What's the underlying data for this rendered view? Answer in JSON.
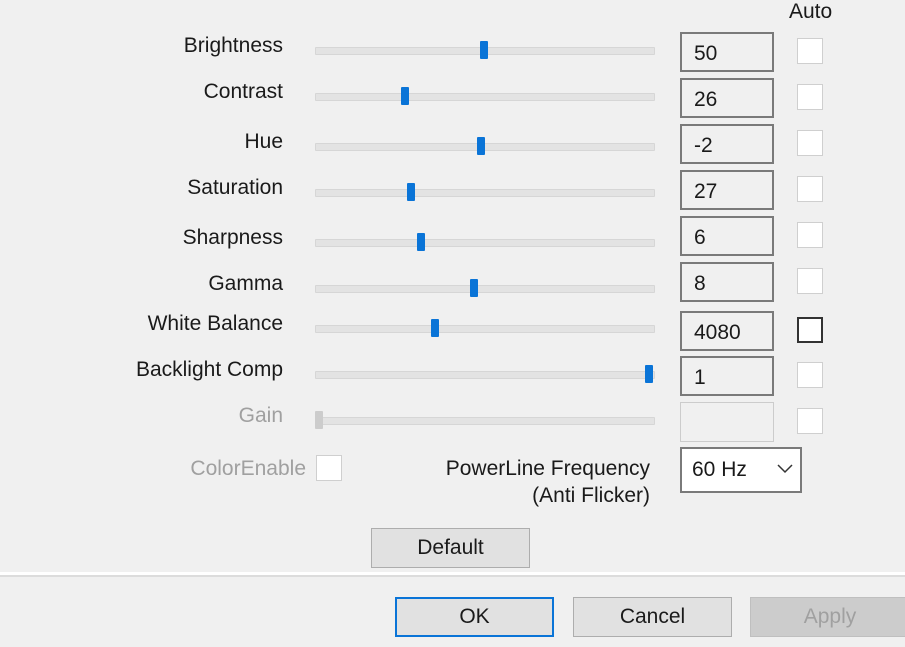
{
  "header": {
    "auto_label": "Auto"
  },
  "controls": [
    {
      "label": "Brightness",
      "value": "50",
      "fraction": 0.5,
      "auto": false,
      "disabled": false
    },
    {
      "label": "Contrast",
      "value": "26",
      "fraction": 0.26,
      "auto": false,
      "disabled": false
    },
    {
      "label": "Hue",
      "value": "-2",
      "fraction": 0.49,
      "auto": false,
      "disabled": false
    },
    {
      "label": "Saturation",
      "value": "27",
      "fraction": 0.28,
      "auto": false,
      "disabled": false
    },
    {
      "label": "Sharpness",
      "value": "6",
      "fraction": 0.31,
      "auto": false,
      "disabled": false
    },
    {
      "label": "Gamma",
      "value": "8",
      "fraction": 0.47,
      "auto": false,
      "disabled": false
    },
    {
      "label": "White Balance",
      "value": "4080",
      "fraction": 0.35,
      "auto": false,
      "disabled": false
    },
    {
      "label": "Backlight Comp",
      "value": "1",
      "fraction": 1.0,
      "auto": false,
      "disabled": false
    },
    {
      "label": "Gain",
      "value": "",
      "fraction": 0.0,
      "auto": false,
      "disabled": true
    }
  ],
  "color_enable": {
    "label": "ColorEnable",
    "checked": false
  },
  "powerline": {
    "label_line1": "PowerLine Frequency",
    "label_line2": "(Anti Flicker)",
    "selected": "60 Hz"
  },
  "buttons": {
    "default": "Default",
    "ok": "OK",
    "cancel": "Cancel",
    "apply": "Apply"
  }
}
